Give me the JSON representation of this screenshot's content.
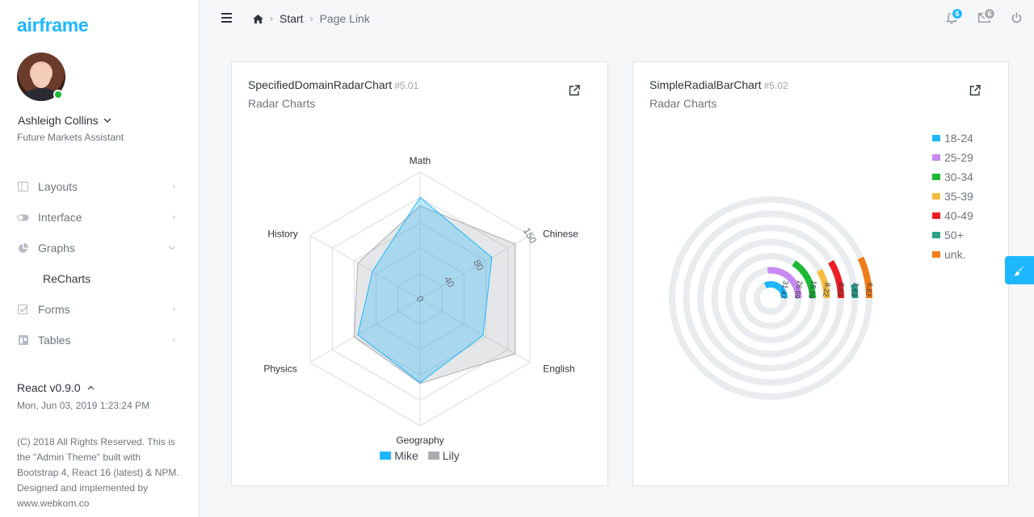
{
  "brand": "airframe",
  "user": {
    "name": "Ashleigh Collins",
    "role": "Future Markets Assistant"
  },
  "nav": {
    "items": [
      {
        "label": "Layouts",
        "icon": "columns-icon"
      },
      {
        "label": "Interface",
        "icon": "toggle-icon"
      },
      {
        "label": "Graphs",
        "icon": "pie-chart-icon"
      },
      {
        "label": "ReCharts",
        "icon": ""
      },
      {
        "label": "Forms",
        "icon": "check-square-icon"
      },
      {
        "label": "Tables",
        "icon": "table-icon"
      }
    ]
  },
  "footer": {
    "version": "React v0.9.0",
    "datetime": "Mon, Jun 03, 2019 1:23:24 PM",
    "copyright": "(C) 2018 All Rights Reserved. This is the \"Admin Theme\" built with Bootstrap 4, React 16 (latest) & NPM. Designed and implemented by www.webkom.co"
  },
  "breadcrumb": {
    "start": "Start",
    "page": "Page Link"
  },
  "notifications": {
    "bell_count": "6",
    "mail_count": "6"
  },
  "colors": {
    "accent": "#1eb7ff",
    "online": "#1bb934"
  },
  "radar_card": {
    "title": "SpecifiedDomainRadarChart",
    "num": "#5.01",
    "subtitle": "Radar Charts"
  },
  "radial_card": {
    "title": "SimpleRadialBarChart",
    "num": "#5.02",
    "subtitle": "Radar Charts"
  },
  "chart_data": [
    {
      "type": "radar",
      "categories": [
        "Math",
        "Chinese",
        "English",
        "Geography",
        "Physics",
        "History"
      ],
      "radius_ticks": [
        "0",
        "40",
        "80",
        "150"
      ],
      "domain": [
        0,
        150
      ],
      "series": [
        {
          "name": "Mike",
          "color": "#1eb7ff",
          "values": [
            120,
            98,
            86,
            99,
            85,
            65
          ]
        },
        {
          "name": "Lily",
          "color": "#a8acb1",
          "values": [
            110,
            130,
            130,
            100,
            90,
            85
          ]
        }
      ]
    },
    {
      "type": "radialbar",
      "max": 100,
      "series": [
        {
          "name": "18-24",
          "value": 31.47,
          "label": "31.47",
          "color": "#1eb7ff"
        },
        {
          "name": "25-29",
          "value": 26.69,
          "label": "26.69",
          "color": "#c989f2"
        },
        {
          "name": "30-34",
          "value": 15.69,
          "label": "15.69",
          "color": "#1bb934"
        },
        {
          "name": "35-39",
          "value": 8.22,
          "label": "8.22",
          "color": "#f6bc41"
        },
        {
          "name": "40-49",
          "value": 8.63,
          "label": "8.63",
          "color": "#ed1c24"
        },
        {
          "name": "50+",
          "value": 2.63,
          "label": "2.63",
          "color": "#2ba18c"
        },
        {
          "name": "unk.",
          "value": 6.67,
          "label": "6.67",
          "color": "#f07c1a"
        }
      ]
    }
  ]
}
